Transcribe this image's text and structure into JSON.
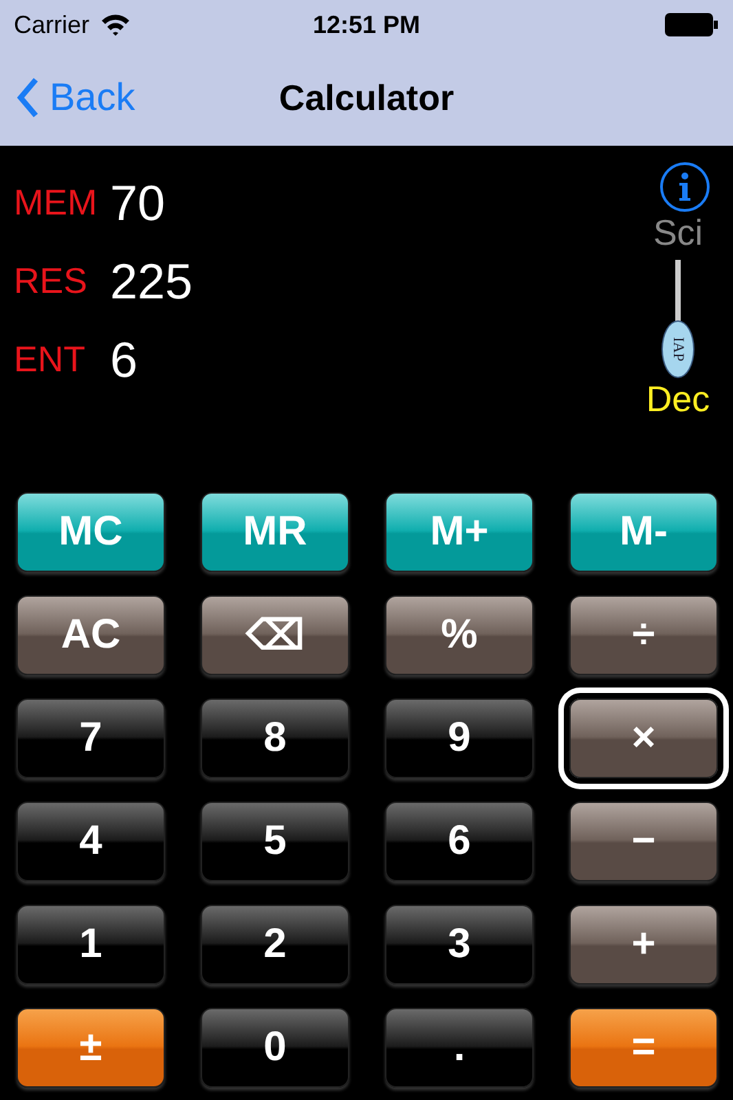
{
  "status_bar": {
    "carrier": "Carrier",
    "time": "12:51 PM"
  },
  "nav_bar": {
    "back": "Back",
    "title": "Calculator"
  },
  "registers": [
    {
      "label": "MEM",
      "value": "70"
    },
    {
      "label": "RES",
      "value": "225"
    },
    {
      "label": "ENT",
      "value": "6"
    }
  ],
  "mode_switch": {
    "options": [
      {
        "label": "Sci",
        "selected": false
      },
      {
        "label": "Dec",
        "selected": true
      }
    ],
    "thumb_label": "IAP"
  },
  "keys": [
    {
      "label": "MC",
      "kind": "memory",
      "selected": false
    },
    {
      "label": "MR",
      "kind": "memory",
      "selected": false
    },
    {
      "label": "M+",
      "kind": "memory",
      "selected": false
    },
    {
      "label": "M-",
      "kind": "memory",
      "selected": false
    },
    {
      "label": "AC",
      "kind": "function",
      "selected": false
    },
    {
      "label": "⌫",
      "kind": "function",
      "selected": false
    },
    {
      "label": "%",
      "kind": "function",
      "selected": false
    },
    {
      "label": "÷",
      "kind": "function",
      "selected": false
    },
    {
      "label": "7",
      "kind": "digit",
      "selected": false
    },
    {
      "label": "8",
      "kind": "digit",
      "selected": false
    },
    {
      "label": "9",
      "kind": "digit",
      "selected": false
    },
    {
      "label": "×",
      "kind": "function",
      "selected": true
    },
    {
      "label": "4",
      "kind": "digit",
      "selected": false
    },
    {
      "label": "5",
      "kind": "digit",
      "selected": false
    },
    {
      "label": "6",
      "kind": "digit",
      "selected": false
    },
    {
      "label": "−",
      "kind": "function",
      "selected": false
    },
    {
      "label": "1",
      "kind": "digit",
      "selected": false
    },
    {
      "label": "2",
      "kind": "digit",
      "selected": false
    },
    {
      "label": "3",
      "kind": "digit",
      "selected": false
    },
    {
      "label": "+",
      "kind": "function",
      "selected": false
    },
    {
      "label": "±",
      "kind": "accent",
      "selected": false
    },
    {
      "label": "0",
      "kind": "digit",
      "selected": false
    },
    {
      "label": ".",
      "kind": "digit",
      "selected": false
    },
    {
      "label": "=",
      "kind": "accent",
      "selected": false
    }
  ]
}
